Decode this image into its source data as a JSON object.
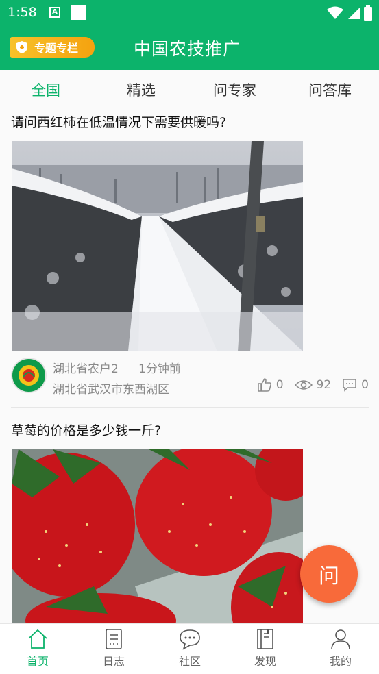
{
  "status_bar": {
    "time": "1:58",
    "a_icon": "A"
  },
  "app_bar": {
    "special_label": "专题专栏",
    "title": "中国农技推广"
  },
  "tabs": [
    {
      "label": "全国",
      "active": true
    },
    {
      "label": "精选",
      "active": false
    },
    {
      "label": "问专家",
      "active": false
    },
    {
      "label": "问答库",
      "active": false
    }
  ],
  "posts": [
    {
      "question": "请问西红柿在低温情况下需要供暖吗?",
      "image": "snow-greenhouse",
      "user": "湖北省农户2",
      "time_ago": "1分钟前",
      "location": "湖北省武汉市东西湖区",
      "likes": "0",
      "views": "92",
      "comments": "0"
    },
    {
      "question": "草莓的价格是多少钱一斤?",
      "image": "strawberries"
    }
  ],
  "fab_label": "问",
  "bottom_nav": [
    {
      "label": "首页",
      "icon": "home-icon",
      "active": true
    },
    {
      "label": "日志",
      "icon": "journal-icon",
      "active": false
    },
    {
      "label": "社区",
      "icon": "chat-icon",
      "active": false
    },
    {
      "label": "发现",
      "icon": "book-icon",
      "active": false
    },
    {
      "label": "我的",
      "icon": "person-icon",
      "active": false
    }
  ],
  "colors": {
    "primary": "#0cb36b",
    "badge": "#f5a20f",
    "fab": "#f86a3a"
  }
}
